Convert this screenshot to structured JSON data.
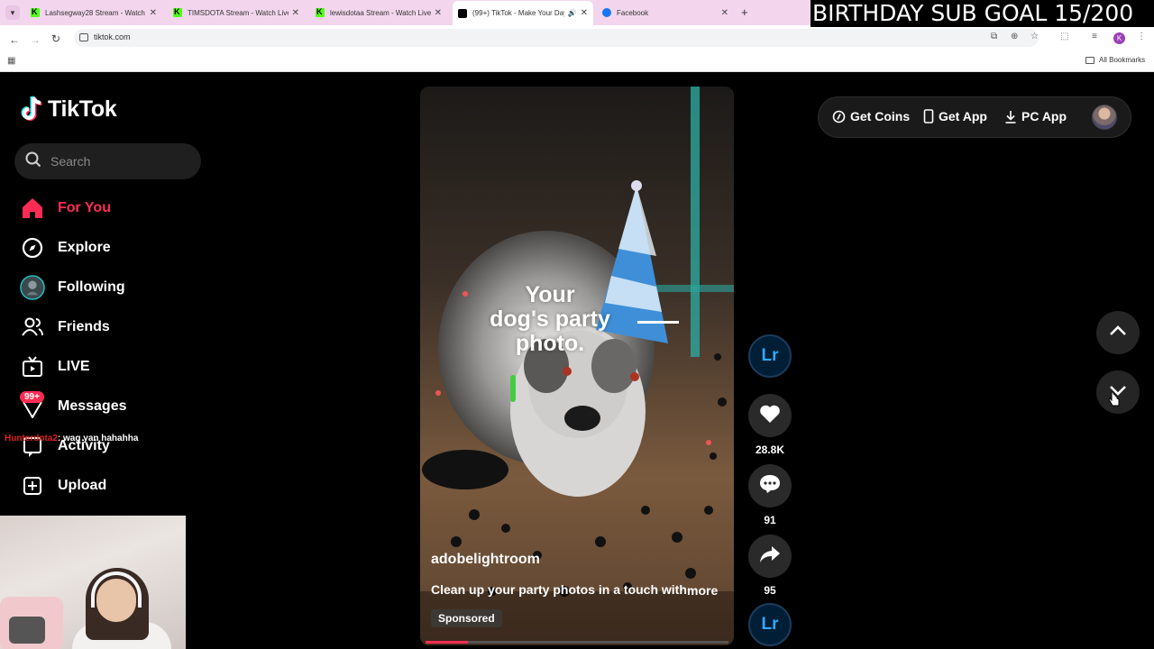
{
  "browser": {
    "tabs": [
      {
        "title": "Lashsegway28 Stream - Watch Live",
        "favicon": "kick-icon"
      },
      {
        "title": "TIMSDOTA Stream - Watch Live",
        "favicon": "kick-icon"
      },
      {
        "title": "lewisdotaa Stream - Watch Live",
        "favicon": "kick-icon"
      },
      {
        "title": "(99+) TikTok - Make Your Day",
        "favicon": "tiktok-icon",
        "active": true
      },
      {
        "title": "Facebook",
        "favicon": "facebook-icon"
      }
    ],
    "url": "tiktok.com",
    "profile_initial": "K",
    "all_bookmarks_label": "All Bookmarks"
  },
  "stream_overlay": {
    "goal_text": "BIRTHDAY SUB GOAL 15/200",
    "chat": {
      "user": "Hunterdota2",
      "separator": ":",
      "message": " wag yan hahahha"
    }
  },
  "sidebar": {
    "logo_text": "TikTok",
    "search_placeholder": "Search",
    "items": [
      {
        "label": "For You",
        "icon": "home-icon",
        "active": true
      },
      {
        "label": "Explore",
        "icon": "compass-icon"
      },
      {
        "label": "Following",
        "icon": "following-avatar-icon"
      },
      {
        "label": "Friends",
        "icon": "friends-icon"
      },
      {
        "label": "LIVE",
        "icon": "live-tv-icon"
      },
      {
        "label": "Messages",
        "icon": "inbox-icon"
      },
      {
        "label": "Activity",
        "icon": "activity-icon"
      },
      {
        "label": "Upload",
        "icon": "upload-icon"
      }
    ],
    "messages_badge": "99+"
  },
  "video": {
    "overlay_text": [
      "Your",
      "dog's party",
      "photo."
    ],
    "author": "adobelightroom",
    "caption": "Clean up your party photos in a touch with",
    "more_label": "more",
    "sponsored_label": "Sponsored",
    "progress": 0.14
  },
  "actions": {
    "brand_label": "Lr",
    "likes": "28.8K",
    "comments": "91",
    "shares": "95"
  },
  "header": {
    "get_coins": "Get Coins",
    "get_app": "Get App",
    "pc_app": "PC App"
  },
  "colors": {
    "accent": "#fe2c55",
    "lightroom": "#31a8ff",
    "background": "#000000"
  }
}
